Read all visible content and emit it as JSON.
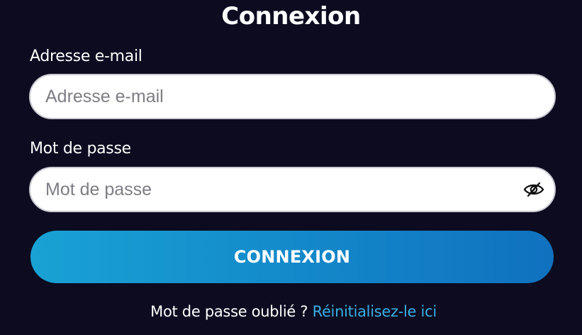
{
  "form": {
    "title": "Connexion",
    "email": {
      "label": "Adresse e-mail",
      "value": "",
      "placeholder": "Adresse e-mail"
    },
    "password": {
      "label": "Mot de passe",
      "value": "",
      "placeholder": "Mot de passe",
      "toggle_icon": "eye-slash-icon"
    },
    "submit_label": "CONNEXION",
    "forgot": {
      "question": "Mot de passe oublié ?",
      "link_label": "Réinitialisez-le ici"
    }
  },
  "colors": {
    "background": "#0c0b20",
    "button_gradient_start": "#19a2d4",
    "button_gradient_end": "#1071bf",
    "link": "#3aaee4"
  }
}
